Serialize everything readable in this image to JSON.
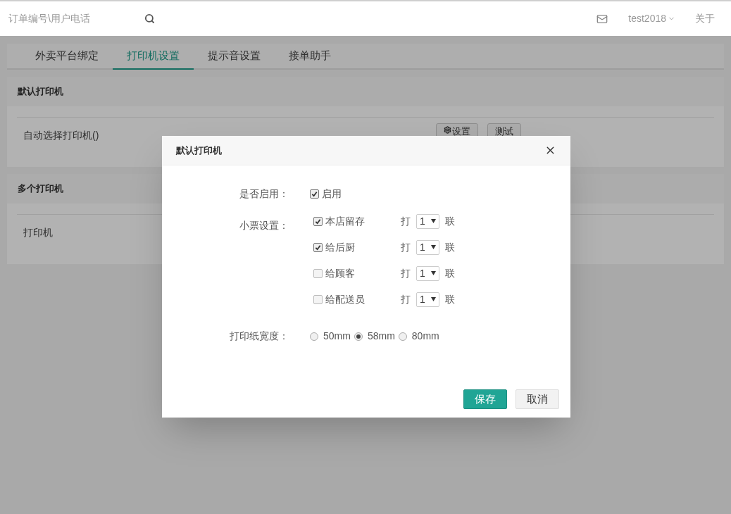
{
  "top_bar": {
    "search": {
      "placeholder": "订单编号\\用户电话"
    },
    "user": "test2018",
    "about": "关于"
  },
  "tabs": [
    {
      "label": "外卖平台绑定",
      "selected": false
    },
    {
      "label": "打印机设置",
      "selected": true
    },
    {
      "label": "提示音设置",
      "selected": false
    },
    {
      "label": "接单助手",
      "selected": false
    }
  ],
  "panels": [
    {
      "title": "默认打印机",
      "row": "自动选择打印机()",
      "buttons": [
        {
          "label": "设置",
          "kind": "gear"
        },
        {
          "label": "测试",
          "kind": "plain"
        }
      ]
    },
    {
      "title": "多个打印机",
      "row": "打印机"
    }
  ],
  "dialog": {
    "title": "默认打印机",
    "enable": {
      "label": "是否启用：",
      "option": "启用",
      "checked": true
    },
    "tickets": {
      "label": "小票设置：",
      "items": [
        {
          "name": "本店留存",
          "checked": true,
          "prefix": "打",
          "copies": "1",
          "suffix": "联"
        },
        {
          "name": "给后厨",
          "checked": true,
          "prefix": "打",
          "copies": "1",
          "suffix": "联"
        },
        {
          "name": "给顾客",
          "checked": false,
          "prefix": "打",
          "copies": "1",
          "suffix": "联"
        },
        {
          "name": "给配送员",
          "checked": false,
          "prefix": "打",
          "copies": "1",
          "suffix": "联"
        }
      ]
    },
    "paper": {
      "label": "打印纸宽度：",
      "options": [
        {
          "label": "50mm",
          "selected": false
        },
        {
          "label": "58mm",
          "selected": true
        },
        {
          "label": "80mm",
          "selected": false
        }
      ]
    },
    "save": "保存",
    "cancel": "取消"
  }
}
